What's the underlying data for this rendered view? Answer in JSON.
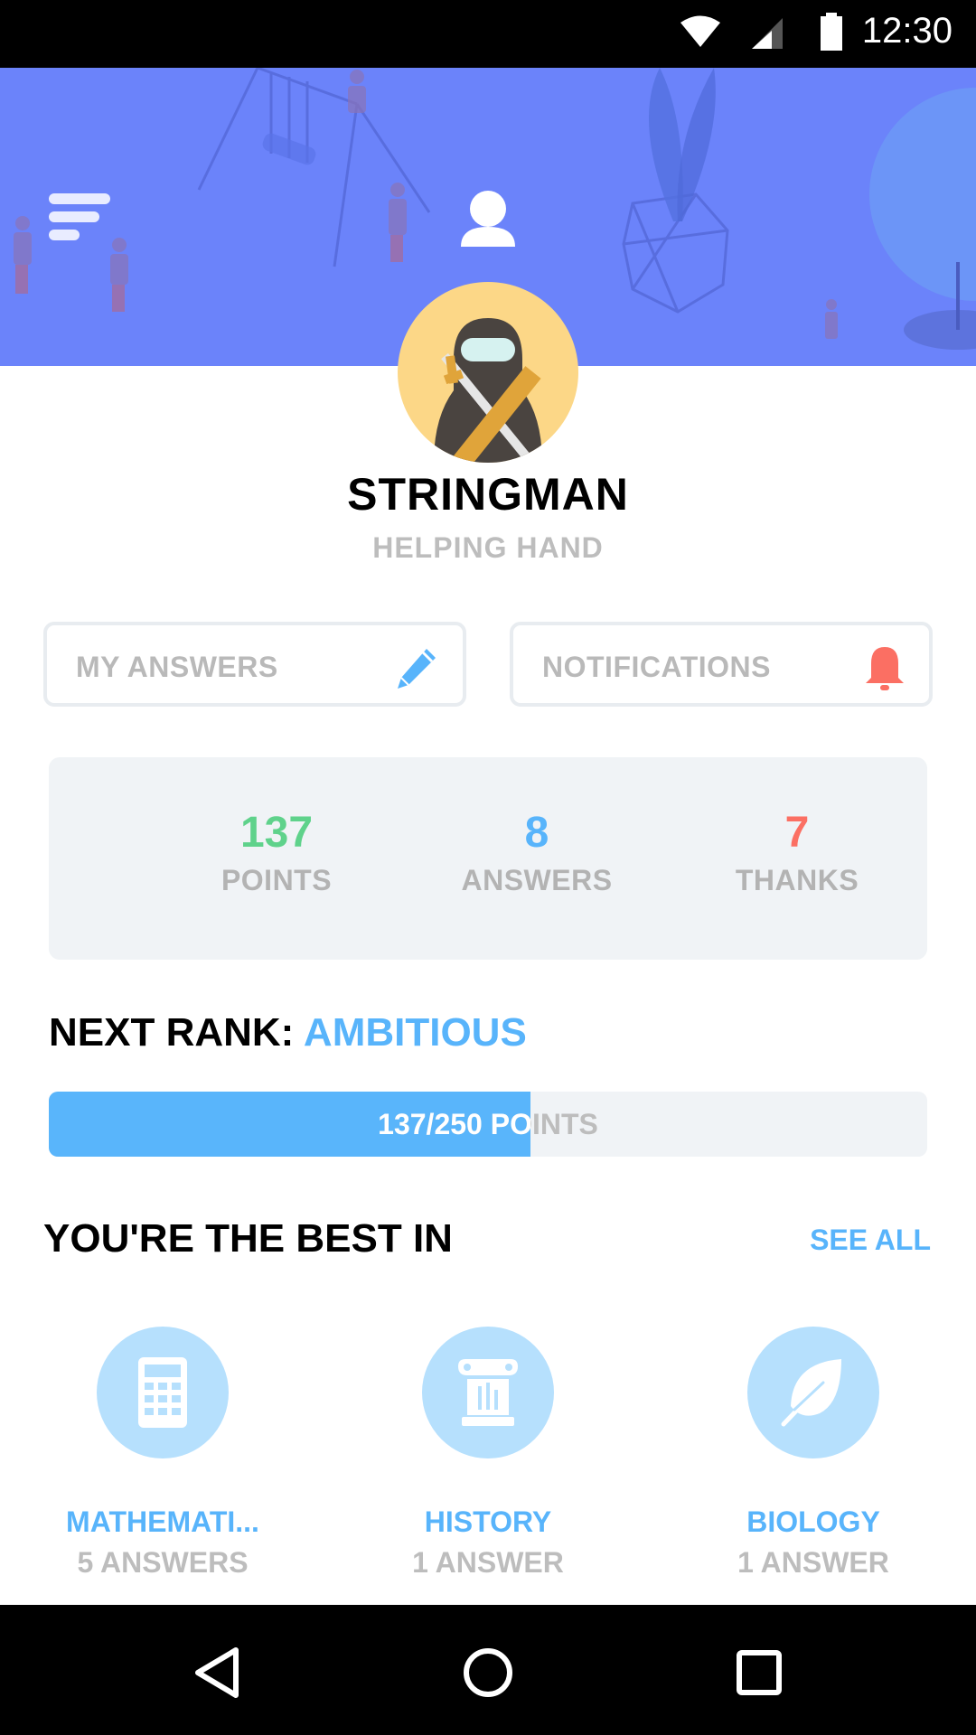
{
  "status_bar": {
    "time": "12:30",
    "icons": [
      "wifi-icon",
      "signal-icon",
      "battery-icon"
    ]
  },
  "header": {
    "menu_icon": "menu-icon",
    "profile_icon": "user-icon"
  },
  "profile": {
    "username": "STRINGMAN",
    "rank": "HELPING HAND",
    "avatar": "ninja-avatar"
  },
  "actions": {
    "my_answers": {
      "label": "MY ANSWERS",
      "icon": "pencil-icon"
    },
    "notifications": {
      "label": "NOTIFICATIONS",
      "icon": "bell-icon"
    }
  },
  "stats": {
    "points": {
      "value": "137",
      "label": "POINTS",
      "color": "#5fd28b"
    },
    "answers": {
      "value": "8",
      "label": "ANSWERS",
      "color": "#58b4fb"
    },
    "thanks": {
      "value": "7",
      "label": "THANKS",
      "color": "#fb6f63"
    }
  },
  "next_rank": {
    "prefix": "NEXT RANK:",
    "name": "AMBITIOUS",
    "progress_text": "137/250 POINTS",
    "current": 137,
    "target": 250
  },
  "best_in": {
    "title": "YOU'RE THE BEST IN",
    "see_all": "SEE ALL",
    "subjects": [
      {
        "name": "MATHEMATI...",
        "count": "5 ANSWERS",
        "icon": "calculator-icon"
      },
      {
        "name": "HISTORY",
        "count": "1 ANSWER",
        "icon": "column-icon"
      },
      {
        "name": "BIOLOGY",
        "count": "1 ANSWER",
        "icon": "leaf-icon"
      }
    ]
  },
  "colors": {
    "banner": "#6b83fa",
    "accent": "#58b4fb",
    "muted": "#bdbdbd",
    "panel": "#f0f3f6"
  }
}
